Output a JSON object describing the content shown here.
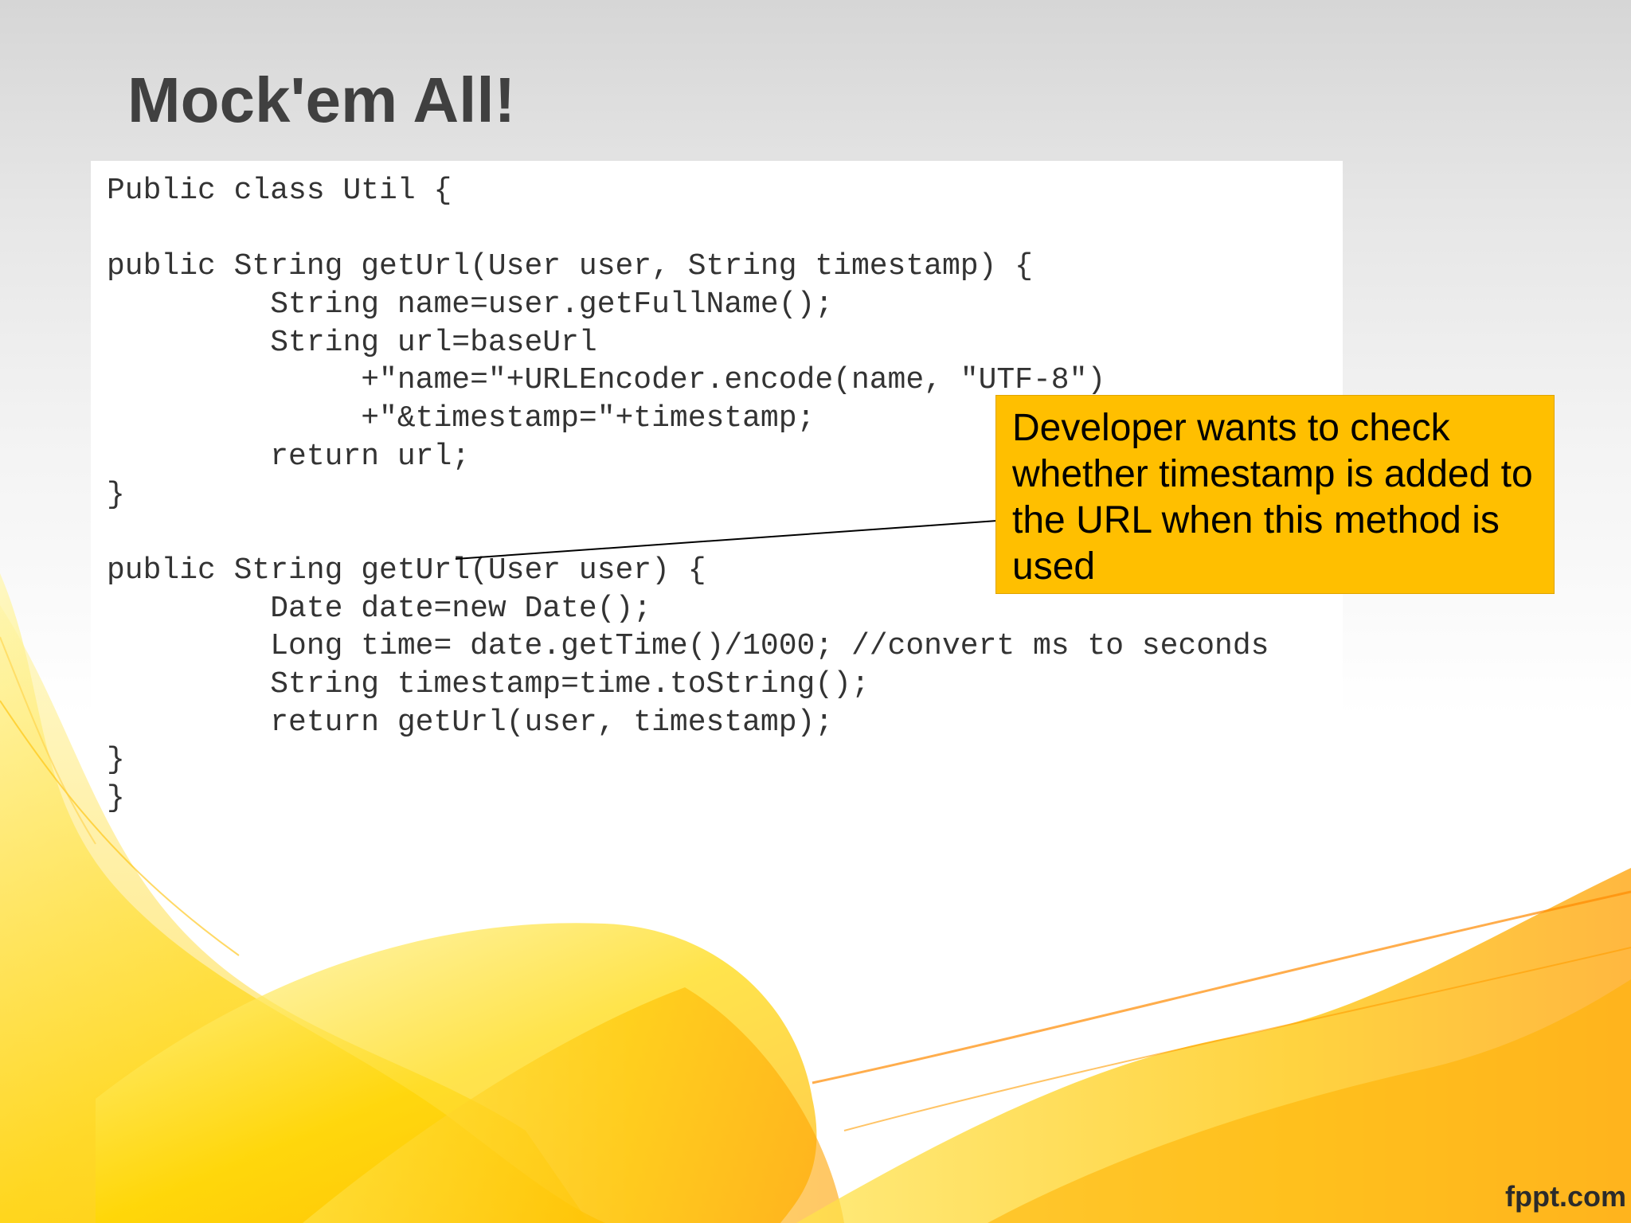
{
  "slide": {
    "title": "Mock'em All!",
    "code_lines": [
      "Public class Util {",
      "",
      "public String getUrl(User user, String timestamp) {",
      "         String name=user.getFullName();",
      "         String url=baseUrl",
      "              +\"name=\"+URLEncoder.encode(name, \"UTF-8\")",
      "              +\"&timestamp=\"+timestamp;",
      "         return url;",
      "}",
      "",
      "public String getUrl(User user) {",
      "         Date date=new Date();",
      "         Long time= date.getTime()/1000; //convert ms to seconds",
      "         String timestamp=time.toString();",
      "         return getUrl(user, timestamp);",
      "}",
      "}"
    ],
    "callout": "Developer wants to check whether timestamp is added to the URL when this method is used",
    "brand": "fppt.com"
  },
  "colors": {
    "title": "#404040",
    "code_text": "#333333",
    "callout_fill": "#ffbf00",
    "swoosh_yellow": "#ffd400",
    "swoosh_orange": "#ff9c00"
  }
}
